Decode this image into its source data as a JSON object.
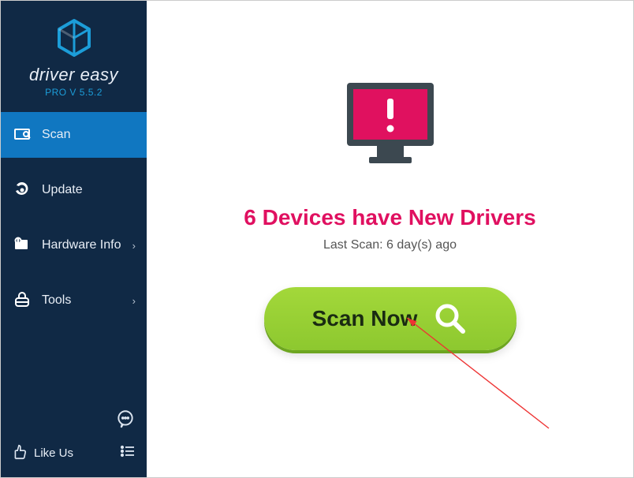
{
  "app": {
    "brand": "driver easy",
    "version": "PRO V 5.5.2"
  },
  "sidebar": {
    "items": [
      {
        "label": "Scan"
      },
      {
        "label": "Update"
      },
      {
        "label": "Hardware Info"
      },
      {
        "label": "Tools"
      }
    ],
    "like_us": "Like Us"
  },
  "main": {
    "headline": "6 Devices have New Drivers",
    "last_scan": "Last Scan: 6 day(s) ago",
    "scan_button": "Scan Now"
  },
  "colors": {
    "accent_pink": "#e01060",
    "sidebar_bg": "#102945",
    "sidebar_active": "#1077c1",
    "button_green": "#8dc82f"
  }
}
